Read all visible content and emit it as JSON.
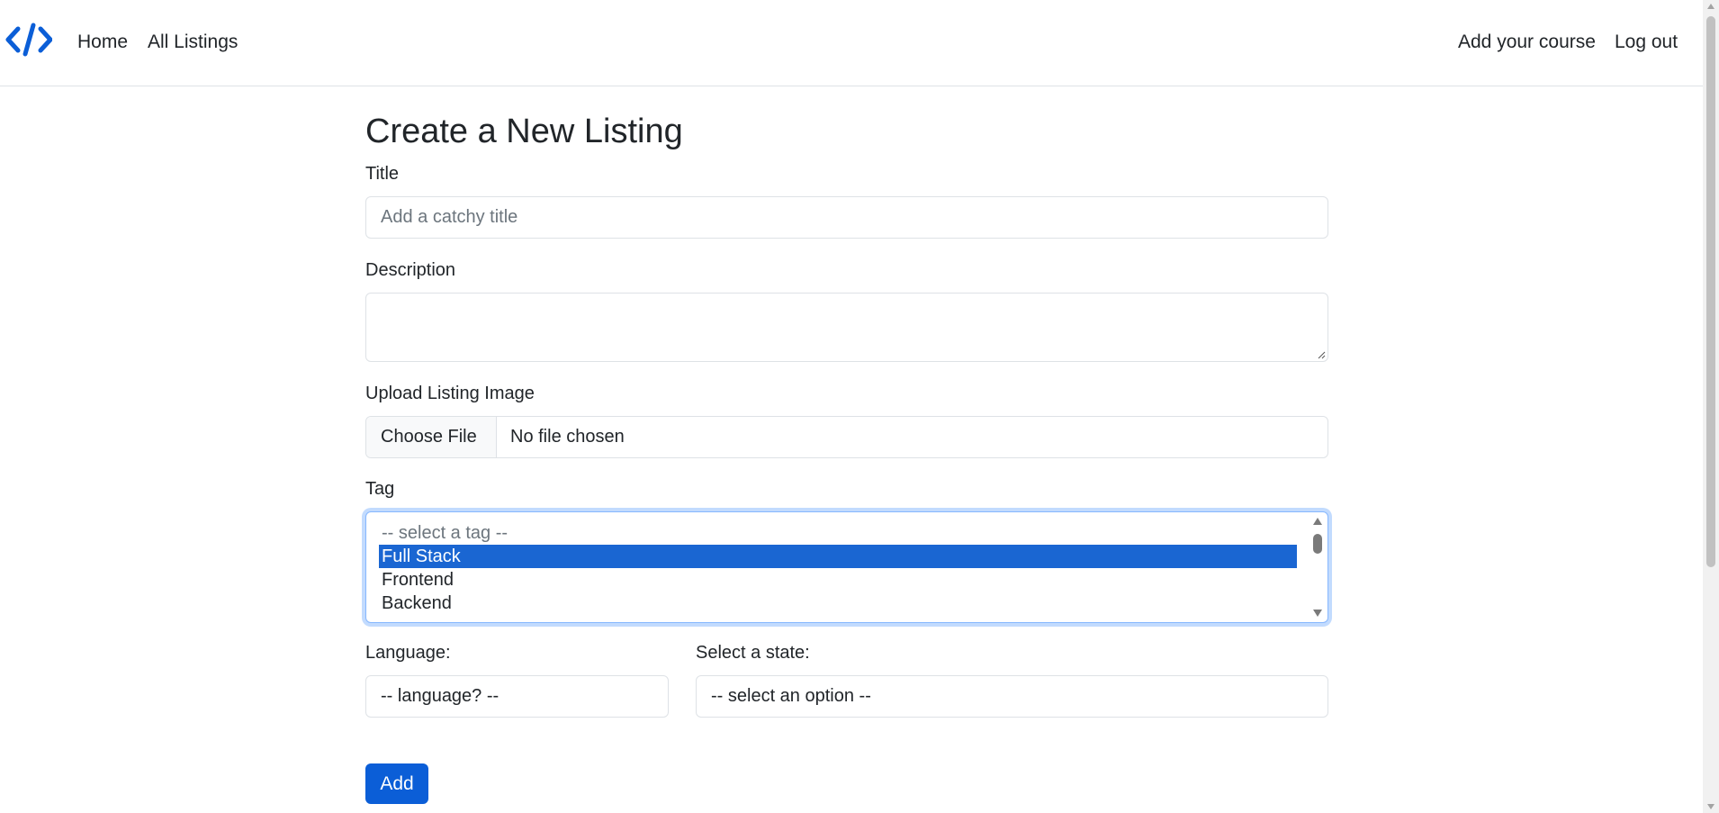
{
  "navbar": {
    "brand_icon": "code-icon",
    "brand_color": "#0b5ed7",
    "links_left": [
      "Home",
      "All Listings"
    ],
    "links_right": [
      "Add your course",
      "Log out"
    ]
  },
  "form": {
    "heading": "Create a New Listing",
    "title": {
      "label": "Title",
      "placeholder": "Add a catchy title",
      "value": ""
    },
    "description": {
      "label": "Description",
      "value": ""
    },
    "image": {
      "label": "Upload Listing Image",
      "button_label": "Choose File",
      "status": "No file chosen"
    },
    "tag": {
      "label": "Tag",
      "options": [
        "-- select a tag --",
        "Full Stack",
        "Frontend",
        "Backend"
      ],
      "selected": "Full Stack"
    },
    "language": {
      "label": "Language:",
      "value": "-- language? --"
    },
    "state": {
      "label": "Select a state:",
      "value": "-- select an option --"
    },
    "submit_label": "Add"
  },
  "colors": {
    "primary": "#0b5ed7",
    "selected_option": "#1a66d2",
    "border": "#dee2e6",
    "focus_ring": "#86b7fe"
  }
}
